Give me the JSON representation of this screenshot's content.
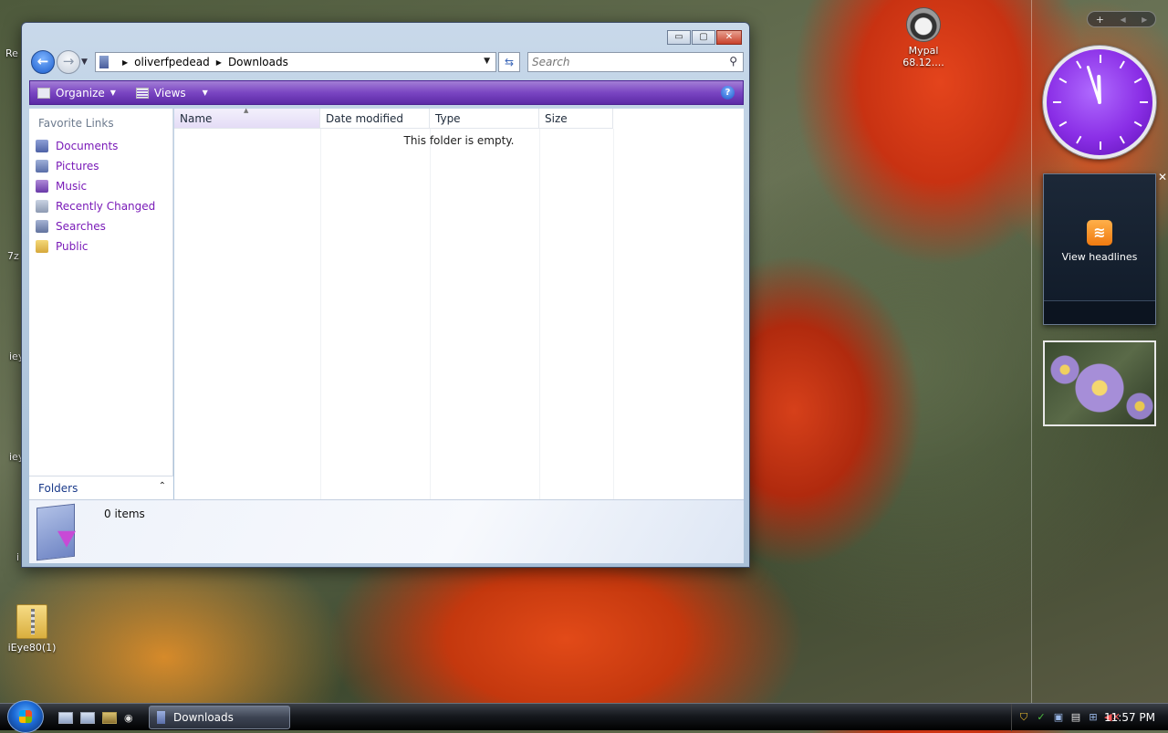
{
  "desktop": {
    "icons": [
      {
        "label": "iEye80(1)"
      },
      {
        "label": "Mypal\n68.12...."
      }
    ],
    "partial_labels": [
      "Re",
      "7z",
      "iey",
      "iey",
      "i"
    ]
  },
  "window": {
    "title_buttons": {
      "minimize": "▭",
      "maximize": "▢",
      "close": "✕"
    },
    "address": {
      "segments": [
        "oliverfpedead",
        "Downloads"
      ]
    },
    "search": {
      "placeholder": "Search"
    },
    "command_bar": {
      "organize": "Organize",
      "views": "Views",
      "help": "?"
    },
    "nav_pane": {
      "title": "Favorite Links",
      "links": [
        {
          "label": "Documents",
          "icon": "documents-icon"
        },
        {
          "label": "Pictures",
          "icon": "pictures-icon"
        },
        {
          "label": "Music",
          "icon": "music-icon"
        },
        {
          "label": "Recently Changed",
          "icon": "recently-changed-icon"
        },
        {
          "label": "Searches",
          "icon": "searches-icon"
        },
        {
          "label": "Public",
          "icon": "public-folder-icon"
        }
      ],
      "folders_label": "Folders"
    },
    "columns": [
      "Name",
      "Date modified",
      "Type",
      "Size"
    ],
    "sorted_column": "Name",
    "empty_message": "This folder is empty.",
    "details": {
      "item_count": "0 items"
    }
  },
  "gadgets": {
    "toolbar": {
      "add": "+",
      "prev": "◀",
      "next": "▶"
    },
    "clock": {
      "hour": 11,
      "minute": 57
    },
    "rss": {
      "label": "View headlines"
    },
    "photo": {
      "subject": "purple asters"
    }
  },
  "taskbar": {
    "active_window": "Downloads",
    "time": "11:57 PM"
  },
  "colors": {
    "accent": "#7a45c2",
    "link": "#7a1bb8",
    "clock_face": "#8a2ee6"
  }
}
